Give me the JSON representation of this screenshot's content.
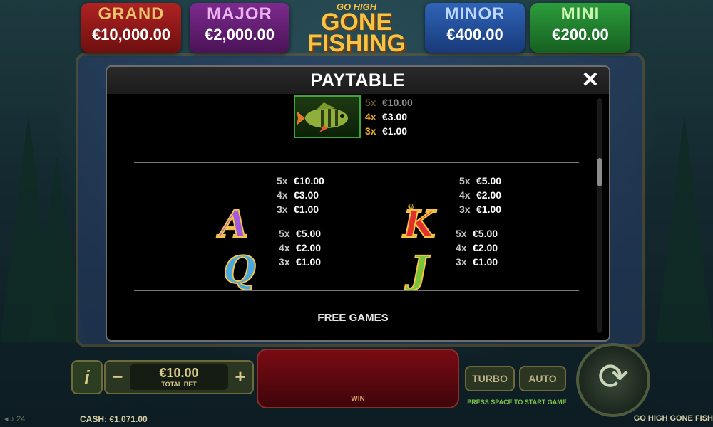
{
  "jackpots": {
    "grand": {
      "name": "GRAND",
      "value": "€10,000.00"
    },
    "major": {
      "name": "MAJOR",
      "value": "€2,000.00"
    },
    "minor": {
      "name": "MINOR",
      "value": "€400.00"
    },
    "mini": {
      "name": "MINI",
      "value": "€200.00"
    }
  },
  "logo": {
    "line1": "GO HIGH",
    "line2": "GONE",
    "line3": "FISHING"
  },
  "paytable": {
    "title": "PAYTABLE",
    "close_icon": "close-icon",
    "fish": {
      "pays": [
        {
          "count": "5x",
          "amount": "€10.00"
        },
        {
          "count": "4x",
          "amount": "€3.00"
        },
        {
          "count": "3x",
          "amount": "€1.00"
        }
      ]
    },
    "symbols": [
      {
        "letter": "A",
        "pays": [
          {
            "count": "5x",
            "amount": "€10.00"
          },
          {
            "count": "4x",
            "amount": "€3.00"
          },
          {
            "count": "3x",
            "amount": "€1.00"
          }
        ]
      },
      {
        "letter": "K",
        "pays": [
          {
            "count": "5x",
            "amount": "€5.00"
          },
          {
            "count": "4x",
            "amount": "€2.00"
          },
          {
            "count": "3x",
            "amount": "€1.00"
          }
        ]
      },
      {
        "letter": "Q",
        "pays": [
          {
            "count": "5x",
            "amount": "€5.00"
          },
          {
            "count": "4x",
            "amount": "€2.00"
          },
          {
            "count": "3x",
            "amount": "€1.00"
          }
        ]
      },
      {
        "letter": "J",
        "pays": [
          {
            "count": "5x",
            "amount": "€5.00"
          },
          {
            "count": "4x",
            "amount": "€2.00"
          },
          {
            "count": "3x",
            "amount": "€1.00"
          }
        ]
      }
    ],
    "free_games_heading": "FREE GAMES"
  },
  "controls": {
    "info_label": "i",
    "minus_label": "−",
    "plus_label": "+",
    "total_bet_value": "€10.00",
    "total_bet_label": "TOTAL BET",
    "win_label": "WIN",
    "turbo_label": "TURBO",
    "auto_label": "AUTO",
    "press_hint": "PRESS SPACE TO START GAME",
    "cash": "CASH: €1,071.00",
    "game_title": "GO HIGH GONE FISH"
  },
  "colors": {
    "gold": "#f0b32a",
    "modal_bg": "#000000",
    "header_bg": "#222222"
  }
}
